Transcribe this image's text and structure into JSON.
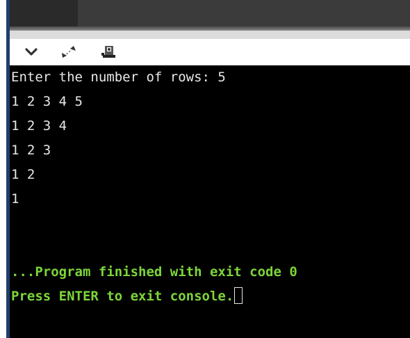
{
  "toolbar": {
    "icons": [
      "chevron-down-icon",
      "expand-icon",
      "settings-icon"
    ]
  },
  "console": {
    "lines": [
      "Enter the number of rows: 5",
      "1 2 3 4 5",
      "1 2 3 4",
      "1 2 3",
      "1 2",
      "1"
    ],
    "finished_line": "...Program finished with exit code 0",
    "press_enter_line": "Press ENTER to exit console.",
    "text_color": "#e8e8e8",
    "status_color": "#7dd63a",
    "background": "#000000"
  }
}
